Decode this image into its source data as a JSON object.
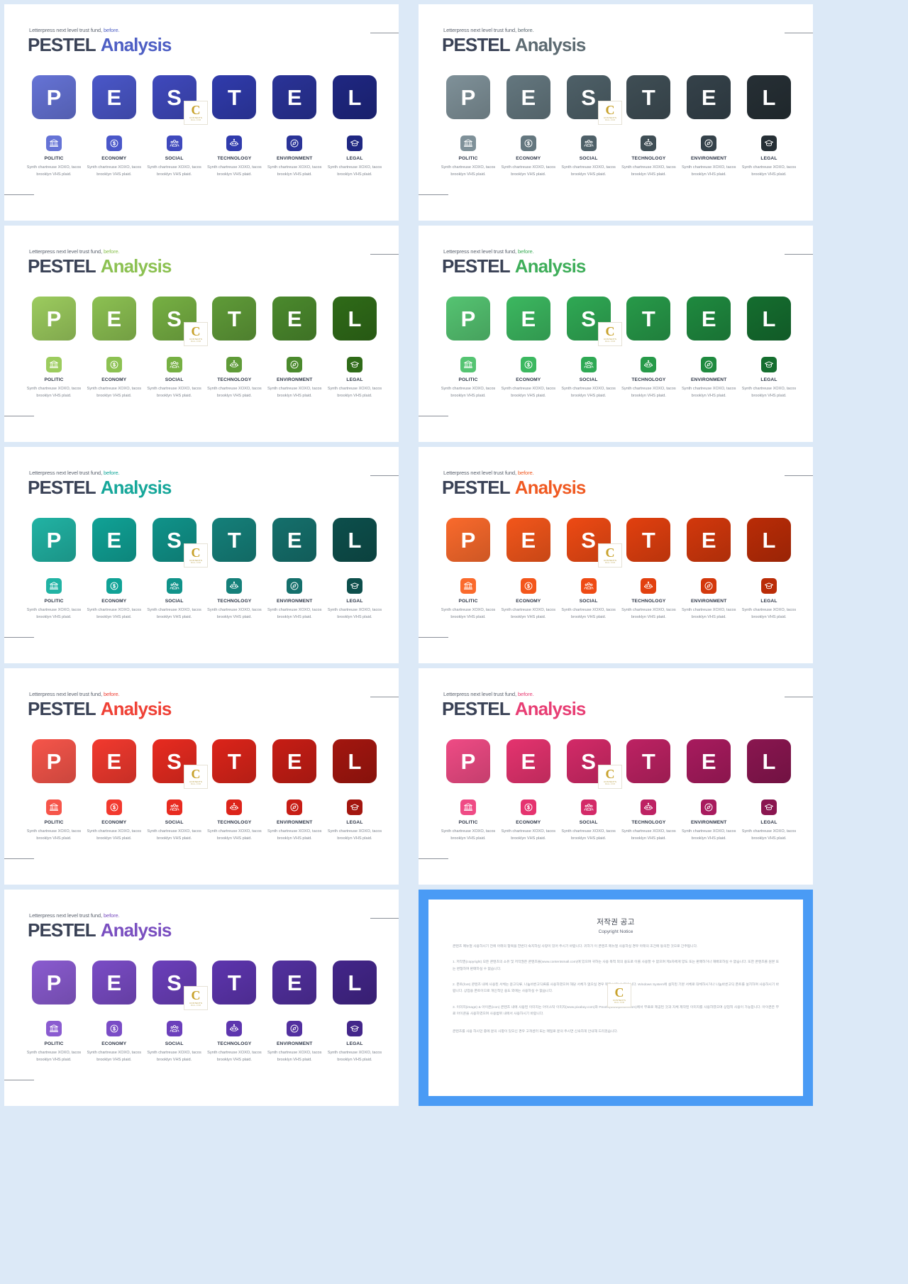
{
  "deck": {
    "eyebrow_plain": "Letterpress next level trust fund,",
    "eyebrow_accent": "before.",
    "title_dark": "PESTEL",
    "title_accent": "Analysis"
  },
  "columns": [
    {
      "letter": "P",
      "icon": "bank-icon",
      "category": "POLITIC",
      "desc": "Synth chartreuse XOXO, tacos brooklyn VHS plaid."
    },
    {
      "letter": "E",
      "icon": "dollar-coin-icon",
      "category": "ECONOMY",
      "desc": "Synth chartreuse XOXO, tacos brooklyn VHS plaid."
    },
    {
      "letter": "S",
      "icon": "people-icon",
      "category": "SOCIAL",
      "desc": "Synth chartreuse XOXO, tacos brooklyn VHS plaid."
    },
    {
      "letter": "T",
      "icon": "robot-icon",
      "category": "TECHNOLOGY",
      "desc": "Synth chartreuse XOXO, tacos brooklyn VHS plaid."
    },
    {
      "letter": "E",
      "icon": "compass-icon",
      "category": "ENVIRONMENT",
      "desc": "Synth chartreuse XOXO, tacos brooklyn VHS plaid."
    },
    {
      "letter": "L",
      "icon": "graduation-icon",
      "category": "LEGAL",
      "desc": "Synth chartreuse XOXO, tacos brooklyn VHS plaid."
    }
  ],
  "slides": [
    {
      "name": "blue-indigo",
      "accent": "#4e5fc4",
      "ramp": [
        "#6573d6",
        "#4a57c9",
        "#3f49bd",
        "#303bac",
        "#2a3398",
        "#1f2782"
      ]
    },
    {
      "name": "slate-gray",
      "accent": "#5d6b72",
      "ramp": [
        "#7f9199",
        "#64777f",
        "#4e6068",
        "#3f4e55",
        "#35424a",
        "#262f35"
      ]
    },
    {
      "name": "light-green",
      "accent": "#8cc152",
      "ramp": [
        "#9ccc5e",
        "#8cc152",
        "#76b043",
        "#5f9b38",
        "#4b8a2d",
        "#2f6b18"
      ]
    },
    {
      "name": "emerald",
      "accent": "#3fae5a",
      "ramp": [
        "#55c472",
        "#3cb860",
        "#2fa954",
        "#279a49",
        "#1f8a3f",
        "#156e2f"
      ]
    },
    {
      "name": "teal",
      "accent": "#16a79a",
      "ramp": [
        "#21b3a4",
        "#10a296",
        "#10938a",
        "#15807a",
        "#15706c",
        "#0d4f4c"
      ]
    },
    {
      "name": "orange",
      "accent": "#f05a22",
      "ramp": [
        "#fa6a2c",
        "#f3561b",
        "#ee4a14",
        "#e2400f",
        "#d3380c",
        "#ba2c07"
      ]
    },
    {
      "name": "red",
      "accent": "#ef4136",
      "ramp": [
        "#f6554a",
        "#f2392e",
        "#e82b20",
        "#dc241a",
        "#c71d15",
        "#a3160f"
      ]
    },
    {
      "name": "pink",
      "accent": "#e83e74",
      "ramp": [
        "#ef4b85",
        "#e5336f",
        "#d32a68",
        "#bd2263",
        "#a81b5e",
        "#8a1650"
      ]
    },
    {
      "name": "purple",
      "accent": "#7a4fc0",
      "ramp": [
        "#8a5bd0",
        "#7a4cc6",
        "#6b3fbb",
        "#5d35ae",
        "#52309f",
        "#43268a"
      ]
    }
  ],
  "stamp": {
    "letter": "C",
    "line1": "CONTENTS",
    "line2": "MALL.COM"
  },
  "copyright": {
    "title_kr": "저작권 공고",
    "title_en": "Copyright Notice",
    "intro": "콘텐츠 메뉴얼 사용하시기 전에 아래의 항목을 한번더 숙지하실 사랑이 있어 주시기 바랍니다. 귀하가 이 콘텐츠 메뉴얼 사용하실 경우 아래의 조건에 동의한 것으로 간주됩니다.",
    "p1": "1. 저작권(copyright) 모든 콘텐츠의 소유 및 저작권은 콘텐츠몰(www.contentsmall.com)에 있으며 귀하는 사용 목적 외의 용도로 이를 사용할 수 없으며 제3자에게 양도 또는 판매하거나 재배포하실 수 없습니다. 또한 콘텐츠를 원본 또는 변형하여 판매하실 수 없습니다.",
    "p2": "2. 폰트(font) 콘텐츠 내에 사용된 서체는 윤고딕류, 나눔바른고딕류를 사용하였으며 해당 서체가 없으실 경우 깨져 보일 수 있습니다. Windows System에 설치된 기본 서체로 대체하시거나 나눔바른고딕 폰트를 설치하여 사용하시기 바랍니다. 상업용 폰트이므로 개인적인 용도 외에는 사용하실 수 없습니다.",
    "p3": "3. 이미지(image) & 아이콘(icon) 콘텐츠 내에 사용된 이미지는 아이스탁 이미지(www.pixabay.com)와 Pexels(www.pexels.com)에서 무료로 제공된 것과 자체 제작된 이미지를 사용하였으며 상업적 사용이 가능합니다. 아이콘은 무료 아이콘을 사용하였으며 사용범위 내에서 사용하시기 바랍니다.",
    "outro": "콘텐츠를 사용 하시던 중에 문의 사항이 있으신 경우 고객센터 또는 메일로 문의 주시면 신속하게 안내해 드리겠습니다."
  }
}
